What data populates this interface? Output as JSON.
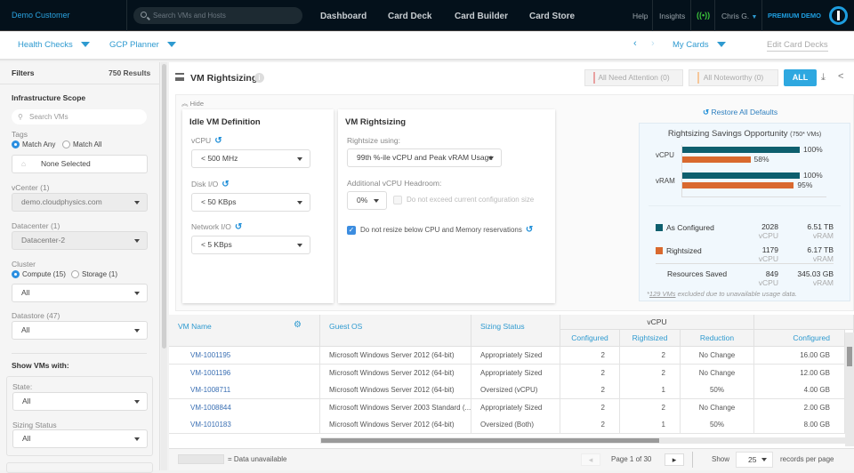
{
  "topbar": {
    "brand": "Demo Customer",
    "search_placeholder": "Search VMs and Hosts",
    "nav": [
      "Dashboard",
      "Card Deck",
      "Card Builder",
      "Card Store"
    ],
    "help": "Help",
    "insights": "Insights",
    "user": "Chris G.",
    "premium": "PREMIUM DEMO"
  },
  "subbar": {
    "health_checks": "Health Checks",
    "gcp_planner": "GCP Planner",
    "my_cards": "My Cards",
    "edit_decks": "Edit Card Decks"
  },
  "sidebar": {
    "filters": "Filters",
    "results": "750 Results",
    "scope": "Infrastructure Scope",
    "search_placeholder": "Search VMs",
    "tags": "Tags",
    "match_any": "Match Any",
    "match_all": "Match All",
    "tags_value": "None Selected",
    "vcenter_label": "vCenter (1)",
    "vcenter_value": "demo.cloudphysics.com",
    "datacenter_label": "Datacenter (1)",
    "datacenter_value": "Datacenter-2",
    "cluster_label": "Cluster",
    "compute": "Compute (15)",
    "storage": "Storage (1)",
    "cluster_value": "All",
    "datastore_label": "Datastore (47)",
    "datastore_value": "All",
    "show_vms": "Show VMs with:",
    "state_label": "State:",
    "state_value": "All",
    "sizing_label": "Sizing Status",
    "sizing_value": "All"
  },
  "main": {
    "title": "VM Rightsizing",
    "need_attention": "All Need Attention (0)",
    "noteworthy": "All Noteworthy (0)",
    "all": "ALL",
    "hide": "Hide",
    "restore": "Restore All Defaults",
    "idle": {
      "title": "Idle VM Definition",
      "vcpu_label": "vCPU",
      "vcpu_value": "< 500 MHz",
      "disk_label": "Disk I/O",
      "disk_value": "< 50 KBps",
      "net_label": "Network I/O",
      "net_value": "< 5 KBps"
    },
    "rightsizing": {
      "title": "VM Rightsizing",
      "using_label": "Rightsize using:",
      "using_value": "99th %-ile vCPU and Peak vRAM Usage",
      "headroom_label": "Additional vCPU Headroom:",
      "headroom_value": "0%",
      "no_exceed": "Do not exceed current configuration size",
      "no_resize": "Do not resize below CPU and Memory reservations"
    }
  },
  "savings": {
    "title": "Rightsizing Savings Opportunity",
    "subtitle": "(750* VMs)",
    "as_configured": "As Configured",
    "rightsized": "Rightsized",
    "resources_saved": "Resources Saved",
    "configured_vcpu": "2028",
    "configured_vram": "6.51 TB",
    "rightsized_vcpu": "1179",
    "rightsized_vram": "6.17 TB",
    "saved_vcpu": "849",
    "saved_vram": "345.03 GB",
    "unit_vcpu": "vCPU",
    "unit_vram": "vRAM",
    "note_link": "129 VMs",
    "note_text": " excluded due to unavailable usage data.",
    "colors": {
      "configured": "#0e5f6e",
      "rightsized": "#d9692e"
    }
  },
  "chart_data": {
    "type": "bar",
    "title": "Rightsizing Savings Opportunity (750* VMs)",
    "categories": [
      "vCPU",
      "vRAM"
    ],
    "series": [
      {
        "name": "As Configured",
        "values": [
          100,
          100
        ]
      },
      {
        "name": "Rightsized",
        "values": [
          58,
          95
        ]
      }
    ],
    "labels": [
      [
        "100%",
        "58%"
      ],
      [
        "100%",
        "95%"
      ]
    ],
    "ylim": [
      0,
      100
    ]
  },
  "table": {
    "headers": {
      "vm_name": "VM Name",
      "guest_os": "Guest OS",
      "sizing_status": "Sizing Status",
      "vcpu_group": "vCPU",
      "configured": "Configured",
      "rightsized": "Rightsized",
      "reduction": "Reduction",
      "vram_configured": "Configured"
    },
    "rows": [
      {
        "name": "VM-1001195",
        "os": "Microsoft Windows Server 2012 (64-bit)",
        "status": "Appropriately Sized",
        "conf": "2",
        "right": "2",
        "red": "No Change",
        "ram": "16.00 GB"
      },
      {
        "name": "VM-1001196",
        "os": "Microsoft Windows Server 2012 (64-bit)",
        "status": "Appropriately Sized",
        "conf": "2",
        "right": "2",
        "red": "No Change",
        "ram": "12.00 GB"
      },
      {
        "name": "VM-1008711",
        "os": "Microsoft Windows Server 2012 (64-bit)",
        "status": "Oversized (vCPU)",
        "conf": "2",
        "right": "1",
        "red": "50%",
        "ram": "4.00 GB"
      },
      {
        "name": "VM-1008844",
        "os": "Microsoft Windows Server 2003 Standard (...",
        "status": "Appropriately Sized",
        "conf": "2",
        "right": "2",
        "red": "No Change",
        "ram": "2.00 GB"
      },
      {
        "name": "VM-1010183",
        "os": "Microsoft Windows Server 2012 (64-bit)",
        "status": "Oversized (Both)",
        "conf": "2",
        "right": "1",
        "red": "50%",
        "ram": "8.00 GB"
      }
    ]
  },
  "footer": {
    "unavailable": "= Data unavailable",
    "page": "Page 1 of 30",
    "show": "Show",
    "per_page_value": "25",
    "per_page_label": "records per page"
  }
}
